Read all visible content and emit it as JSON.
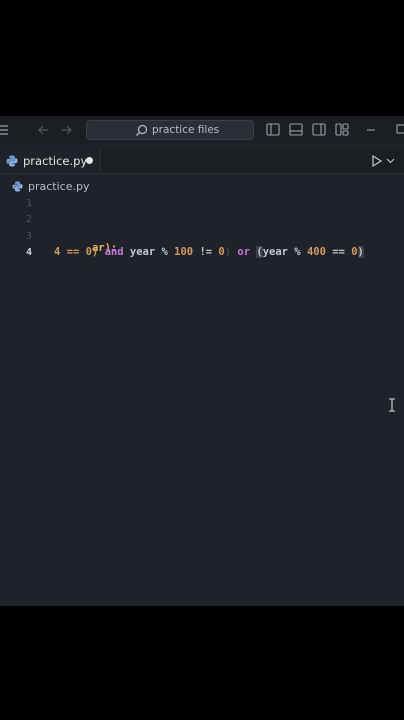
{
  "titlebar": {
    "search_text": "practice files",
    "icons": [
      "menu-icon",
      "back-arrow-icon",
      "forward-arrow-icon",
      "search-icon",
      "layout-left-icon",
      "layout-bottom-icon",
      "layout-right-icon",
      "layout-grid-icon",
      "minimize-icon",
      "maximize-icon"
    ]
  },
  "tab": {
    "label": "practice.py",
    "dirty": true
  },
  "breadcrumb": {
    "file": "practice.py"
  },
  "editor": {
    "lines": [
      {
        "number": "1",
        "active": false,
        "tokens": []
      },
      {
        "number": "2",
        "active": false,
        "tokens": []
      },
      {
        "number": "3",
        "active": false,
        "tokens": [
          {
            "text": "ar):",
            "color": "#e6b566"
          }
        ]
      },
      {
        "number": "4",
        "active": true,
        "tokens": [
          {
            "text": "4 == 0) ",
            "color": "#d19a66"
          },
          {
            "text": "and ",
            "color": "#c678dd"
          },
          {
            "text": "year % ",
            "color": "#c3c8d0"
          },
          {
            "text": "100 ",
            "color": "#d19a66"
          },
          {
            "text": "!= ",
            "color": "#c3c8d0"
          },
          {
            "text": "0",
            "color": "#d19a66"
          },
          {
            "text": ") ",
            "color": "#5a3b40"
          },
          {
            "text": "or ",
            "color": "#c678dd"
          },
          {
            "text": "(",
            "color": "#c3c8d0"
          },
          {
            "text": "year % ",
            "color": "#c3c8d0"
          },
          {
            "text": "400 ",
            "color": "#d19a66"
          },
          {
            "text": "== ",
            "color": "#c3c8d0"
          },
          {
            "text": "0",
            "color": "#d19a66"
          },
          {
            "text": ")",
            "color": "#c3c8d0"
          }
        ]
      }
    ]
  },
  "colors": {
    "background": "#1f2228",
    "titlebar": "#1b1e23",
    "accent_python": "#6f9fd8"
  }
}
